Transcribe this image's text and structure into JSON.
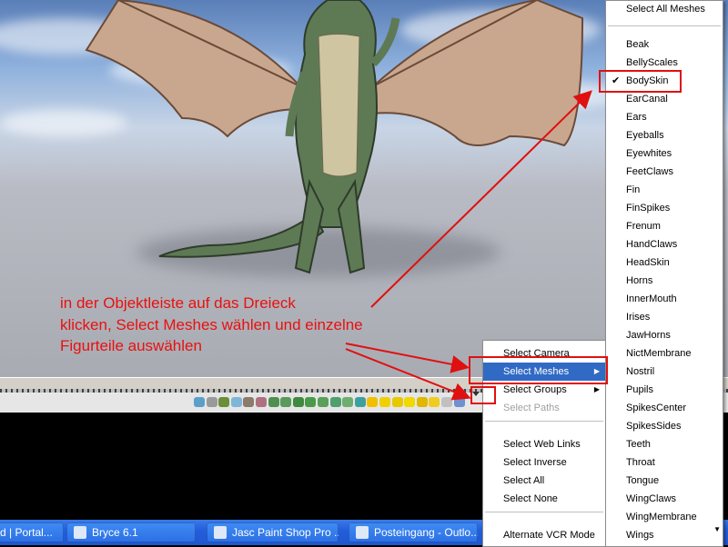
{
  "colors": {
    "annotation_red": "#e8110f",
    "menu_highlight": "#316ac5",
    "taskbar_blue": "#245edb"
  },
  "annotation": {
    "lines": [
      "in der Objektleiste auf das Dreieck",
      "klicken, Select Meshes wählen und einzelne",
      "Figurteile auswählen"
    ]
  },
  "context_menu": {
    "groups": [
      [
        {
          "label": "Select Camera"
        },
        {
          "label": "Select Meshes",
          "submenu": true,
          "highlighted": true
        },
        {
          "label": "Select Groups",
          "submenu": true
        },
        {
          "label": "Select Paths",
          "disabled": true
        }
      ],
      [
        {
          "label": "Select Web Links"
        },
        {
          "label": "Select Inverse"
        },
        {
          "label": "Select All"
        },
        {
          "label": "Select None"
        }
      ],
      [
        {
          "label": "Alternate VCR Mode"
        }
      ]
    ],
    "submenu_arrow": "▶"
  },
  "meshes_menu": {
    "select_all": "Select All Meshes",
    "check_mark": "✔",
    "items": [
      {
        "label": "Beak"
      },
      {
        "label": "BellyScales"
      },
      {
        "label": "BodySkin",
        "checked": true
      },
      {
        "label": "EarCanal"
      },
      {
        "label": "Ears"
      },
      {
        "label": "Eyeballs"
      },
      {
        "label": "Eyewhites"
      },
      {
        "label": "FeetClaws"
      },
      {
        "label": "Fin"
      },
      {
        "label": "FinSpikes"
      },
      {
        "label": "Frenum"
      },
      {
        "label": "HandClaws"
      },
      {
        "label": "HeadSkin"
      },
      {
        "label": "Horns"
      },
      {
        "label": "InnerMouth"
      },
      {
        "label": "Irises"
      },
      {
        "label": "JawHorns"
      },
      {
        "label": "NictMembrane"
      },
      {
        "label": "Nostril"
      },
      {
        "label": "Pupils"
      },
      {
        "label": "SpikesCenter"
      },
      {
        "label": "SpikesSides"
      },
      {
        "label": "Teeth"
      },
      {
        "label": "Throat"
      },
      {
        "label": "Tongue"
      },
      {
        "label": "WingClaws"
      },
      {
        "label": "WingMembrane"
      },
      {
        "label": "Wings"
      }
    ],
    "scroll_down_arrow": "▼"
  },
  "taskbar": {
    "buttons": [
      {
        "label": "d | Portal..."
      },
      {
        "label": "Bryce 6.1"
      },
      {
        "label": "Jasc Paint Shop Pro ..."
      },
      {
        "label": "Posteingang - Outlo..."
      }
    ]
  },
  "toolbar": {
    "icons": [
      "light-icon",
      "flat-icon",
      "tree-icon",
      "sky-icon",
      "rock-icon",
      "metaball-icon",
      "sphere-icon",
      "torus-icon",
      "cube-icon",
      "cylinder-icon",
      "cone-icon",
      "pyramid-icon",
      "disc-icon",
      "square-icon",
      "yellow-cylinder-icon",
      "yellow-cone-icon",
      "yellow-pyramid-icon",
      "yellow-disc-icon",
      "yellow-cube-icon",
      "yellow-sphere-icon",
      "flag-icon",
      "blue-square-icon"
    ]
  }
}
